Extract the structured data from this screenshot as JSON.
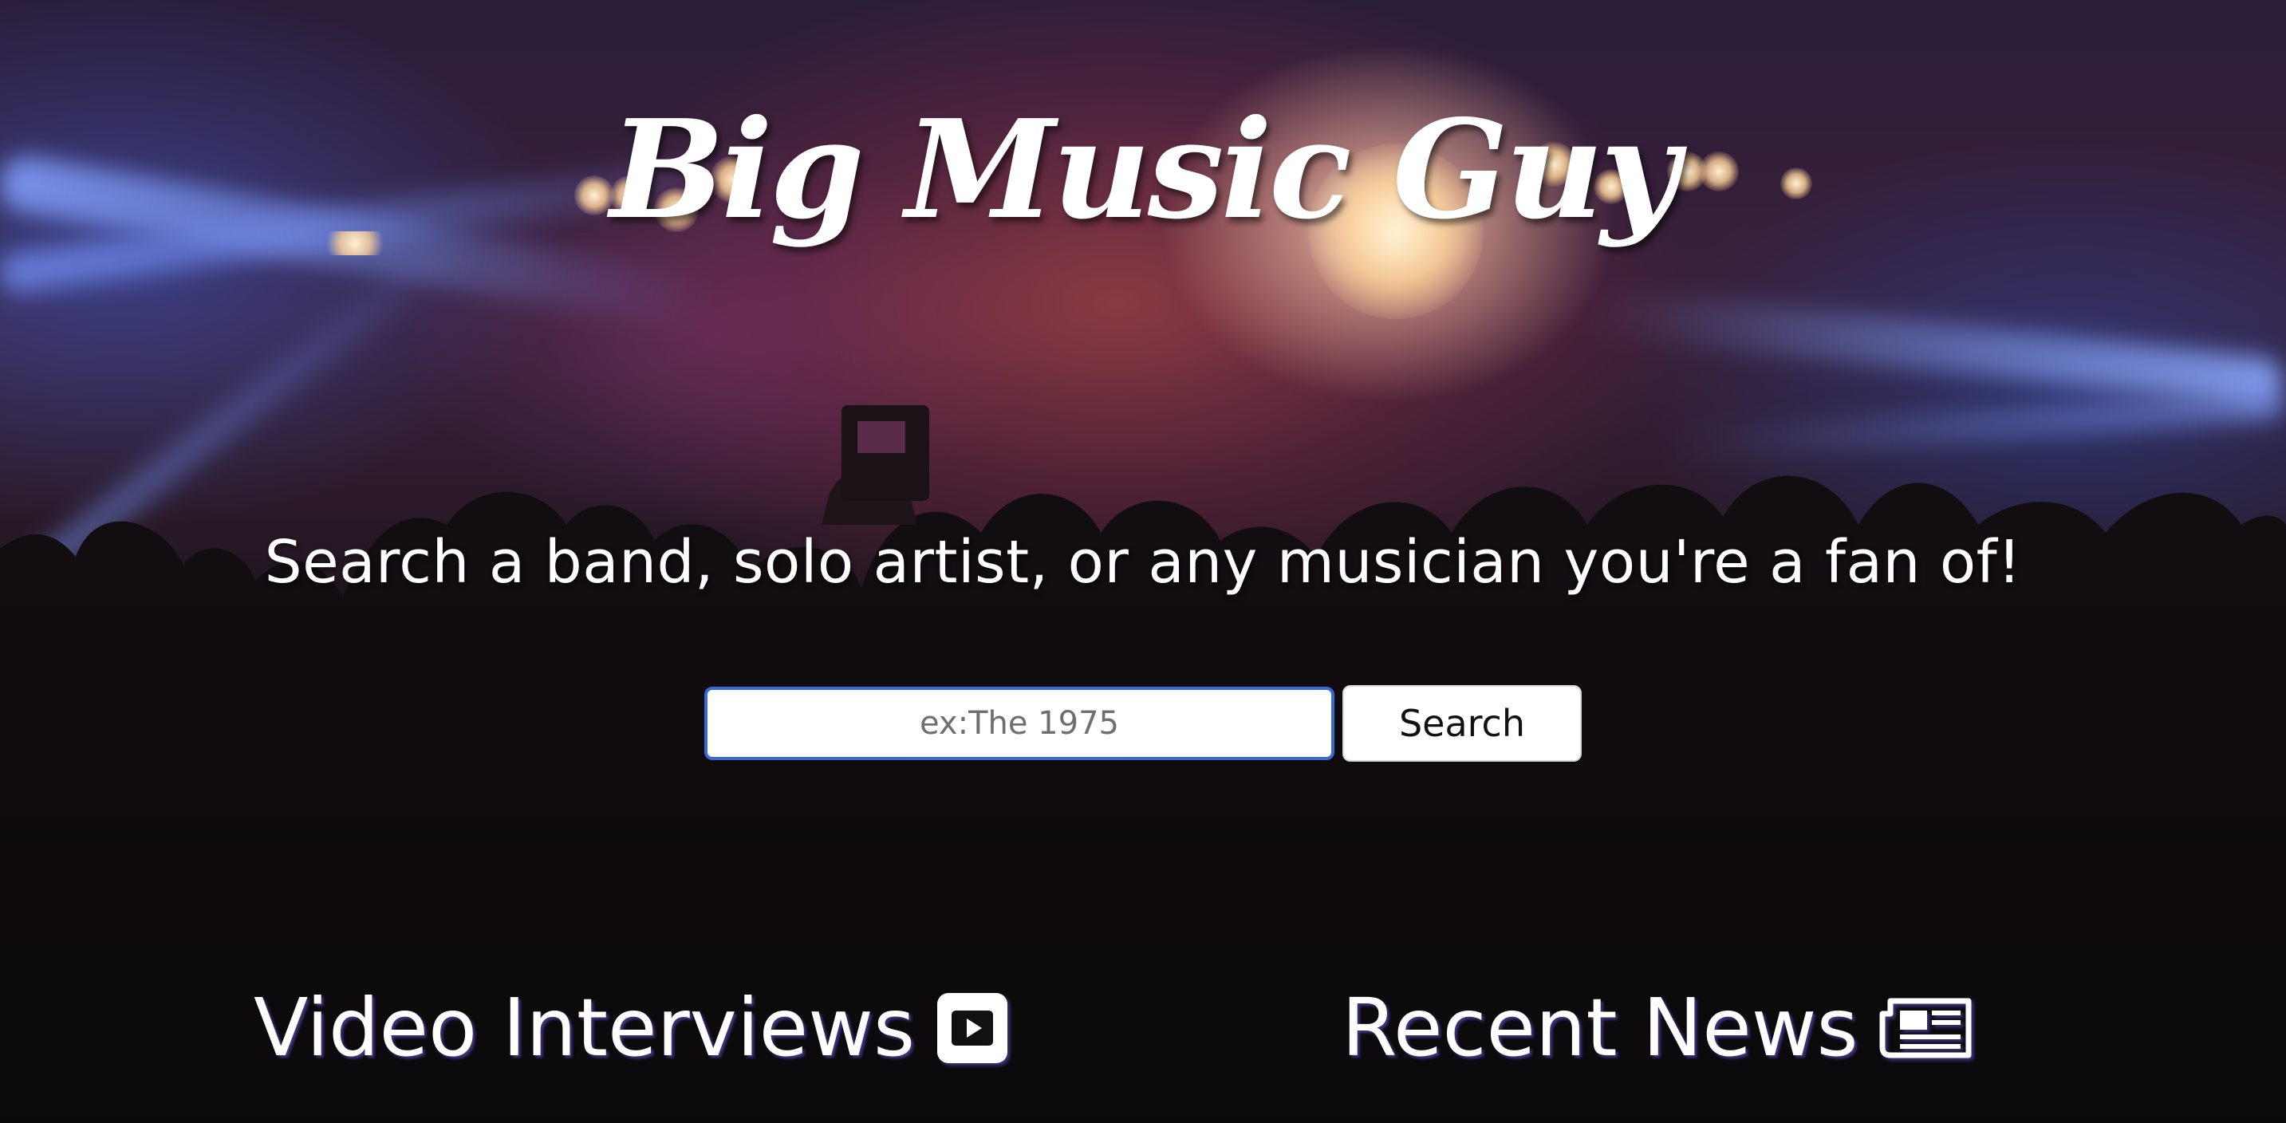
{
  "header": {
    "site_title": "Big Music Guy"
  },
  "hero": {
    "tagline": "Search a band, solo artist, or any musician you're a fan of!"
  },
  "search": {
    "placeholder": "ex:The 1975",
    "value": "",
    "button_label": "Search",
    "focus_color": "#3a68d6"
  },
  "sections": [
    {
      "title": "Video Interviews",
      "icon": "youtube-play-icon"
    },
    {
      "title": "Recent News",
      "icon": "newspaper-icon"
    }
  ],
  "colors": {
    "text": "#ffffff",
    "heading_shadow": "#463c96",
    "button_bg": "#ffffff",
    "button_text": "#111111"
  }
}
